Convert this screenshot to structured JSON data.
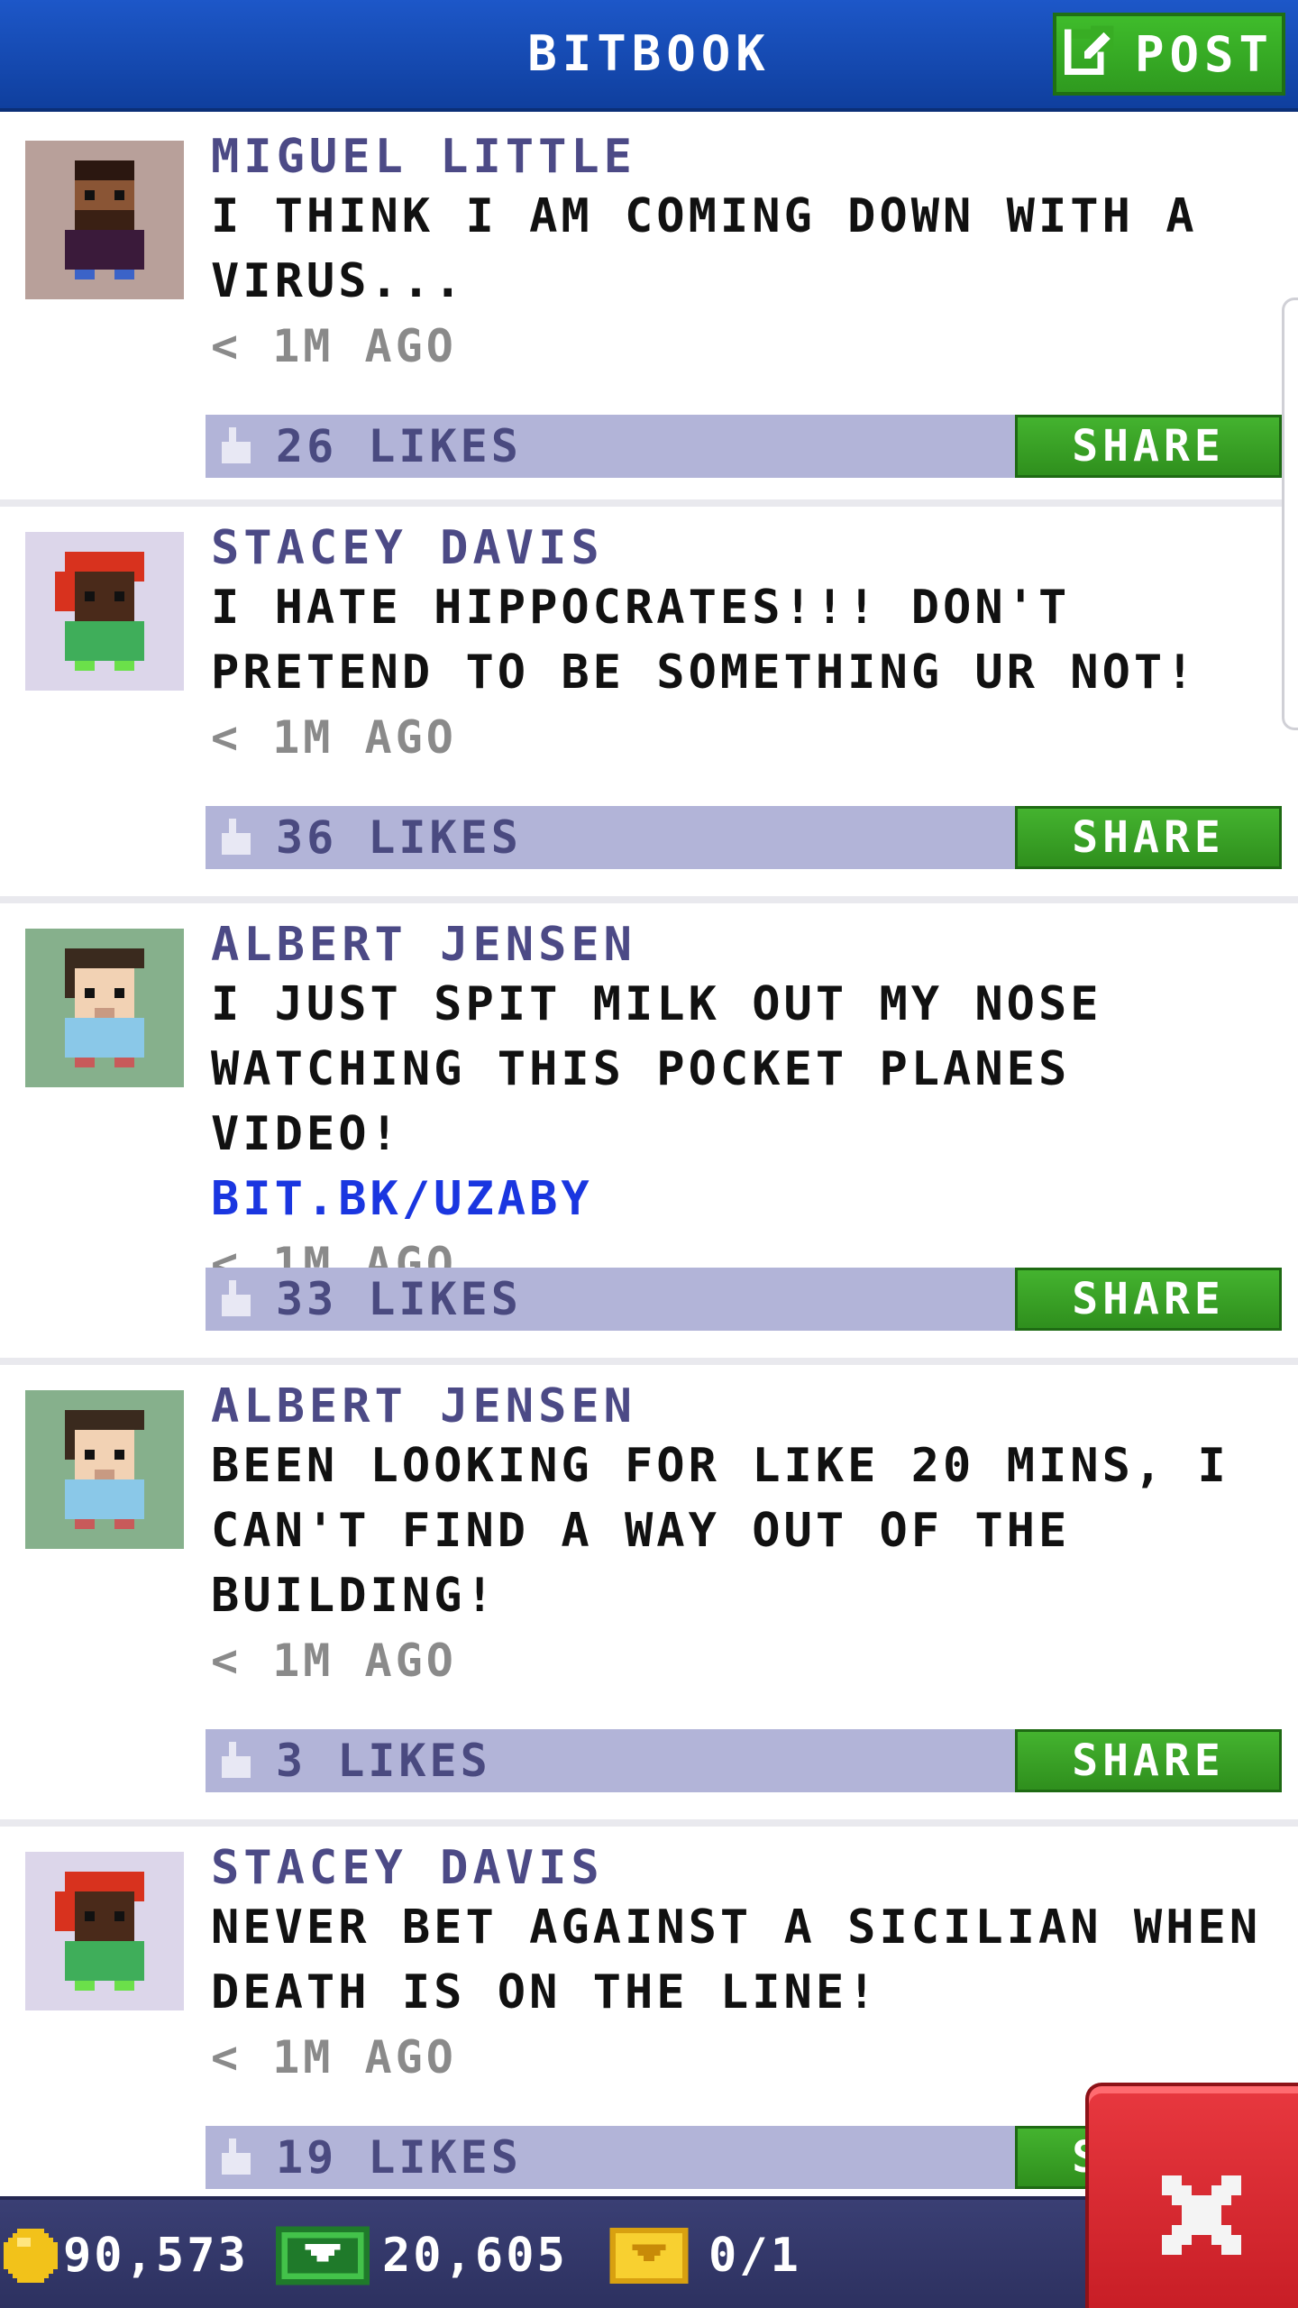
{
  "header": {
    "title": "BITBOOK",
    "post_label": "POST"
  },
  "posts": [
    {
      "author": "MIGUEL LITTLE",
      "message": "I THINK I AM COMING DOWN WITH A VIRUS...",
      "link": "",
      "time": "< 1M AGO",
      "likes": "26 LIKES",
      "share_label": "SHARE",
      "avatar_bg": "#b8a09a"
    },
    {
      "author": "STACEY DAVIS",
      "message": "I HATE HIPPOCRATES!!! DON'T PRETEND TO BE SOMETHING UR NOT!",
      "link": "",
      "time": "< 1M AGO",
      "likes": "36 LIKES",
      "share_label": "SHARE",
      "avatar_bg": "#dcd6ea"
    },
    {
      "author": "ALBERT JENSEN",
      "message": "I JUST SPIT MILK OUT MY NOSE WATCHING THIS POCKET PLANES VIDEO!",
      "link": "BIT.BK/UZABY",
      "time": "< 1M AGO",
      "likes": "33 LIKES",
      "share_label": "SHARE",
      "avatar_bg": "#86b08c"
    },
    {
      "author": "ALBERT JENSEN",
      "message": "BEEN LOOKING FOR LIKE 20 MINS, I CAN'T FIND A WAY OUT OF THE BUILDING!",
      "link": "",
      "time": "< 1M AGO",
      "likes": "3 LIKES",
      "share_label": "SHARE",
      "avatar_bg": "#86b08c"
    },
    {
      "author": "STACEY DAVIS",
      "message": "NEVER BET AGAINST A SICILIAN WHEN DEATH IS ON THE LINE!",
      "link": "",
      "time": "< 1M AGO",
      "likes": "19 LIKES",
      "share_label": "SHARE",
      "avatar_bg": "#dcd6ea"
    }
  ],
  "status": {
    "coins": "90,573",
    "bux": "20,605",
    "tickets": "0/1"
  },
  "colors": {
    "header_blue": "#1d57c8",
    "share_green": "#3da828",
    "like_bar": "#b2b4d8",
    "close_red": "#d8282f"
  },
  "icons": {
    "post": "compose-icon",
    "like": "thumbs-up-icon",
    "coin": "coin-icon",
    "bux": "bux-icon",
    "ticket": "vip-ticket-icon",
    "close": "close-icon"
  }
}
